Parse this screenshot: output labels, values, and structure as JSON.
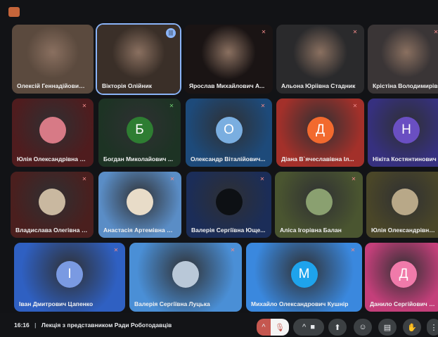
{
  "participants": [
    {
      "name": "Олексій Геннадійович ...",
      "type": "video",
      "bg": "#5b4a3e"
    },
    {
      "name": "Вікторія Олійник",
      "type": "video",
      "bg": "#3a2f28",
      "active": true,
      "speaking": true
    },
    {
      "name": "Ярослав Михайлович А...",
      "type": "video",
      "bg": "#1a1414",
      "muted": true
    },
    {
      "name": "Альона Юріівна Стадник",
      "type": "video",
      "bg": "#2a2a2c",
      "muted": true
    },
    {
      "name": "Крістіна Володимирів",
      "type": "video",
      "bg": "#3a3536",
      "muted": true
    },
    {
      "name": "Юлія Олександрівна Б...",
      "type": "photo",
      "bg": "#4f1c1e",
      "avatar_color": "#d77a86",
      "muted": true
    },
    {
      "name": "Богдан Миколайович ...",
      "type": "letter",
      "initial": "Б",
      "bg": "#1d3324",
      "avatar_color": "#2e7d32",
      "muted": true
    },
    {
      "name": "Олександр Віталійович...",
      "type": "letter",
      "initial": "О",
      "bg": "#1d4a7a",
      "avatar_color": "#7aaee0",
      "muted": true
    },
    {
      "name": "Діана В`ячеславівна Іл...",
      "type": "letter",
      "initial": "Д",
      "bg": "#a3302a",
      "avatar_color": "#f26a2e",
      "muted": true
    },
    {
      "name": "Нікіта Костянтинович",
      "type": "letter",
      "initial": "Н",
      "bg": "#36307f",
      "avatar_color": "#6a4fc2"
    },
    {
      "name": "Владислава Олегівна Л...",
      "type": "photo",
      "bg": "#4a1f1e",
      "avatar_color": "#c9b8a0",
      "muted": true
    },
    {
      "name": "Анастасія Артемівна П...",
      "type": "photo",
      "bg": "#5a8dc6",
      "avatar_color": "#e8dcc8",
      "muted": true
    },
    {
      "name": "Валерія Сергіївна Юще...",
      "type": "photo",
      "bg": "#1b2d58",
      "avatar_color": "#0d1014",
      "muted": true
    },
    {
      "name": "Аліса Ігорівна Балан",
      "type": "photo",
      "bg": "#4a5530",
      "avatar_color": "#8aa070",
      "muted": true
    },
    {
      "name": "Юлія Олександрівна Б",
      "type": "photo",
      "bg": "#4a4628",
      "avatar_color": "#b8a888"
    },
    {
      "name": "Іван Дмитрович Цапенко",
      "type": "letter",
      "initial": "І",
      "bg": "#2f60c2",
      "avatar_color": "#7a9ae2",
      "muted": true
    },
    {
      "name": "Валерія Сергіївна Луцька",
      "type": "photo",
      "bg": "#4a8fd6",
      "avatar_color": "#b9c8d8",
      "muted": true
    },
    {
      "name": "Михайло Олександрович Кушнір",
      "type": "letter",
      "initial": "М",
      "bg": "#3a88de",
      "avatar_color": "#1ea3ec",
      "muted": true
    },
    {
      "name": "Данило Сергійович Хар",
      "type": "letter",
      "initial": "Д",
      "bg": "#c43f7a",
      "avatar_color": "#f07aaa"
    }
  ],
  "footer": {
    "time": "16:16",
    "separator": "|",
    "meeting_title": "Лекція з представником Ради Роботодавців"
  },
  "controls": {
    "mic_icon": "mic-off-icon",
    "chevron": "^",
    "camera_icon": "camera-icon",
    "present_icon": "present-icon",
    "emoji_icon": "emoji-icon",
    "captions_icon": "captions-icon",
    "hand_icon": "raise-hand-icon",
    "more_icon": "more-icon"
  }
}
